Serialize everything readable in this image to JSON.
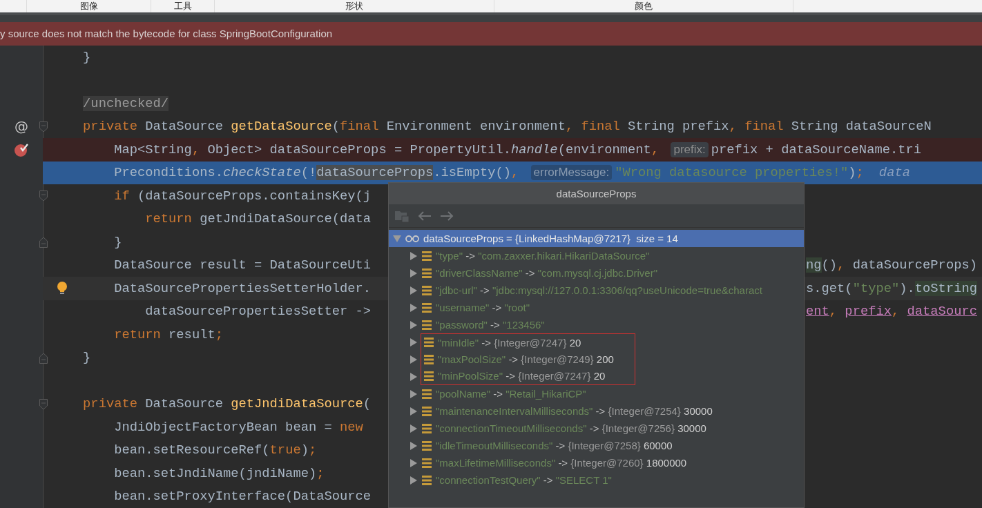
{
  "toolbar": {
    "items": [
      "图像",
      "工具",
      "形状",
      "颜色"
    ]
  },
  "banner": {
    "text": "y source does not match the bytecode for class SpringBootConfiguration"
  },
  "editor": {
    "lines": [
      {
        "kind": "plain",
        "tokens": [
          {
            "kind": "plain",
            "text": "    }"
          }
        ]
      },
      {
        "kind": "plain"
      },
      {
        "kind": "plain",
        "tokens": [
          {
            "kind": "suppressed",
            "text": "    /unchecked/"
          }
        ]
      },
      {
        "kind": "plain",
        "gutter": {
          "kind": "annotation",
          "text": "@"
        },
        "fold": {
          "kind": "open"
        },
        "tokens": [
          {
            "kind": "keyword",
            "text": "    private "
          },
          {
            "kind": "plain",
            "text": "DataSource "
          },
          {
            "kind": "method",
            "text": "getDataSource"
          },
          {
            "kind": "plain",
            "text": "("
          },
          {
            "kind": "keyword",
            "text": "final "
          },
          {
            "kind": "plain",
            "text": "Environment environment"
          },
          {
            "kind": "keyword",
            "text": ", final "
          },
          {
            "kind": "plain",
            "text": "String prefix"
          },
          {
            "kind": "keyword",
            "text": ", final "
          },
          {
            "kind": "plain",
            "text": "String dataSourceN"
          }
        ]
      },
      {
        "kind": "breakpoint",
        "gutter": {
          "kind": "breakpoint"
        },
        "tokens": [
          {
            "kind": "plain",
            "text": "        Map<String"
          },
          {
            "kind": "keyword",
            "text": ", "
          },
          {
            "kind": "plain",
            "text": "Object> dataSourceProps = PropertyUtil."
          },
          {
            "kind": "italic",
            "text": "handle"
          },
          {
            "kind": "plain",
            "text": "(environment"
          },
          {
            "kind": "keyword",
            "text": ", "
          },
          {
            "kind": "hint",
            "text": "prefix:"
          },
          {
            "kind": "plain",
            "text": "prefix + dataSourceName.tri"
          }
        ]
      },
      {
        "kind": "execution",
        "tokens": [
          {
            "kind": "plain",
            "text": "        Preconditions."
          },
          {
            "kind": "italic",
            "text": "checkState"
          },
          {
            "kind": "plain",
            "text": "(!"
          },
          {
            "kind": "highlight",
            "text": "dataSourceProps"
          },
          {
            "kind": "plain",
            "text": ".isEmpty()"
          },
          {
            "kind": "keyword",
            "text": ", "
          },
          {
            "kind": "hint",
            "text": "errorMessage:"
          },
          {
            "kind": "string",
            "text": "\"Wrong datasource properties!\""
          },
          {
            "kind": "plain",
            "text": ")"
          },
          {
            "kind": "keyword",
            "text": ";"
          },
          {
            "kind": "debug",
            "text": "data"
          }
        ]
      },
      {
        "kind": "plain",
        "fold": {
          "kind": "open"
        },
        "tokens": [
          {
            "kind": "keyword",
            "text": "        if "
          },
          {
            "kind": "plain",
            "text": "(dataSourceProps.containsKey(j"
          }
        ]
      },
      {
        "kind": "plain",
        "tokens": [
          {
            "kind": "keyword",
            "text": "            return "
          },
          {
            "kind": "plain",
            "text": "getJndiDataSource(data"
          }
        ]
      },
      {
        "kind": "plain",
        "fold": {
          "kind": "close"
        },
        "tokens": [
          {
            "kind": "plain",
            "text": "        }"
          }
        ]
      },
      {
        "kind": "plain",
        "tokens": [
          {
            "kind": "plain",
            "text": "        DataSource result = DataSourceUti"
          }
        ],
        "right": [
          {
            "kind": "usage",
            "text": "ng"
          },
          {
            "kind": "plain",
            "text": "()"
          },
          {
            "kind": "keyword",
            "text": ", "
          },
          {
            "kind": "plain",
            "text": "dataSourceProps)"
          }
        ]
      },
      {
        "kind": "caret",
        "gutter": {
          "kind": "bulb"
        },
        "tokens": [
          {
            "kind": "plain",
            "text": "        DataSourcePropertiesSetterHolder."
          }
        ],
        "right": [
          {
            "kind": "plain",
            "text": "s.get("
          },
          {
            "kind": "string",
            "text": "\"type\""
          },
          {
            "kind": "plain",
            "text": ")."
          },
          {
            "kind": "usage",
            "text": "toString"
          }
        ]
      },
      {
        "kind": "plain",
        "tokens": [
          {
            "kind": "plain",
            "text": "            dataSourcePropertiesSetter ->"
          }
        ],
        "right": [
          {
            "kind": "field",
            "text": "ent"
          },
          {
            "kind": "keyword",
            "text": ", "
          },
          {
            "kind": "field",
            "text": "prefix"
          },
          {
            "kind": "keyword",
            "text": ", "
          },
          {
            "kind": "field",
            "text": "dataSourc"
          }
        ]
      },
      {
        "kind": "plain",
        "tokens": [
          {
            "kind": "keyword",
            "text": "        return "
          },
          {
            "kind": "plain",
            "text": "result"
          },
          {
            "kind": "keyword",
            "text": ";"
          }
        ]
      },
      {
        "kind": "plain",
        "fold": {
          "kind": "close"
        },
        "tokens": [
          {
            "kind": "plain",
            "text": "    }"
          }
        ]
      },
      {
        "kind": "plain"
      },
      {
        "kind": "plain",
        "fold": {
          "kind": "open"
        },
        "tokens": [
          {
            "kind": "keyword",
            "text": "    private "
          },
          {
            "kind": "plain",
            "text": "DataSource "
          },
          {
            "kind": "method",
            "text": "getJndiDataSource"
          },
          {
            "kind": "plain",
            "text": "("
          }
        ]
      },
      {
        "kind": "plain",
        "tokens": [
          {
            "kind": "plain",
            "text": "        JndiObjectFactoryBean bean = "
          },
          {
            "kind": "keyword",
            "text": "new"
          }
        ]
      },
      {
        "kind": "plain",
        "tokens": [
          {
            "kind": "plain",
            "text": "        bean.setResourceRef("
          },
          {
            "kind": "keyword",
            "text": "true"
          },
          {
            "kind": "plain",
            "text": ")"
          },
          {
            "kind": "keyword",
            "text": ";"
          }
        ]
      },
      {
        "kind": "plain",
        "tokens": [
          {
            "kind": "plain",
            "text": "        bean.setJndiName(jndiName)"
          },
          {
            "kind": "keyword",
            "text": ";"
          }
        ]
      },
      {
        "kind": "plain",
        "tokens": [
          {
            "kind": "plain",
            "text": "        bean.setProxyInterface(DataSource"
          }
        ]
      }
    ]
  },
  "popup": {
    "title": "dataSourceProps",
    "tree": {
      "label": "dataSourceProps = {LinkedHashMap@7217}  size = 14",
      "expanded": true,
      "selected": true,
      "children": [
        {
          "key": "\"type\"",
          "arrow": "->",
          "value": "\"com.zaxxer.hikari.HikariDataSource\"",
          "kind": "string",
          "expanded": false,
          "selected": false
        },
        {
          "key": "\"driverClassName\"",
          "arrow": "->",
          "value": "\"com.mysql.cj.jdbc.Driver\"",
          "kind": "string",
          "expanded": false,
          "selected": false
        },
        {
          "key": "\"jdbc-url\"",
          "arrow": "->",
          "value": "\"jdbc:mysql://127.0.0.1:3306/qq?useUnicode=true&charact",
          "kind": "string",
          "expanded": false,
          "selected": false
        },
        {
          "key": "\"username\"",
          "arrow": "->",
          "value": "\"root\"",
          "kind": "string",
          "expanded": false,
          "selected": false
        },
        {
          "key": "\"password\"",
          "arrow": "->",
          "value": "\"123456\"",
          "kind": "string",
          "expanded": false,
          "selected": false
        },
        {
          "key": "\"minIdle\"",
          "arrow": "->",
          "ref": "{Integer@7247}",
          "value": "20",
          "kind": "integer",
          "expanded": false,
          "selected": false,
          "boxed": true
        },
        {
          "key": "\"maxPoolSize\"",
          "arrow": "->",
          "ref": "{Integer@7249}",
          "value": "200",
          "kind": "integer",
          "expanded": false,
          "selected": false,
          "boxed": true
        },
        {
          "key": "\"minPoolSize\"",
          "arrow": "->",
          "ref": "{Integer@7247}",
          "value": "20",
          "kind": "integer",
          "expanded": false,
          "selected": false,
          "boxed": true
        },
        {
          "key": "\"poolName\"",
          "arrow": "->",
          "value": "\"Retail_HikariCP\"",
          "kind": "string",
          "expanded": false,
          "selected": false
        },
        {
          "key": "\"maintenanceIntervalMilliseconds\"",
          "arrow": "->",
          "ref": "{Integer@7254}",
          "value": "30000",
          "kind": "integer",
          "expanded": false,
          "selected": false
        },
        {
          "key": "\"connectionTimeoutMilliseconds\"",
          "arrow": "->",
          "ref": "{Integer@7256}",
          "value": "30000",
          "kind": "integer",
          "expanded": false,
          "selected": false
        },
        {
          "key": "\"idleTimeoutMilliseconds\"",
          "arrow": "->",
          "ref": "{Integer@7258}",
          "value": "60000",
          "kind": "integer",
          "expanded": false,
          "selected": false
        },
        {
          "key": "\"maxLifetimeMilliseconds\"",
          "arrow": "->",
          "ref": "{Integer@7260}",
          "value": "1800000",
          "kind": "integer",
          "expanded": false,
          "selected": false
        },
        {
          "key": "\"connectionTestQuery\"",
          "arrow": "->",
          "value": "\"SELECT 1\"",
          "kind": "string",
          "expanded": false,
          "selected": false
        }
      ]
    }
  }
}
